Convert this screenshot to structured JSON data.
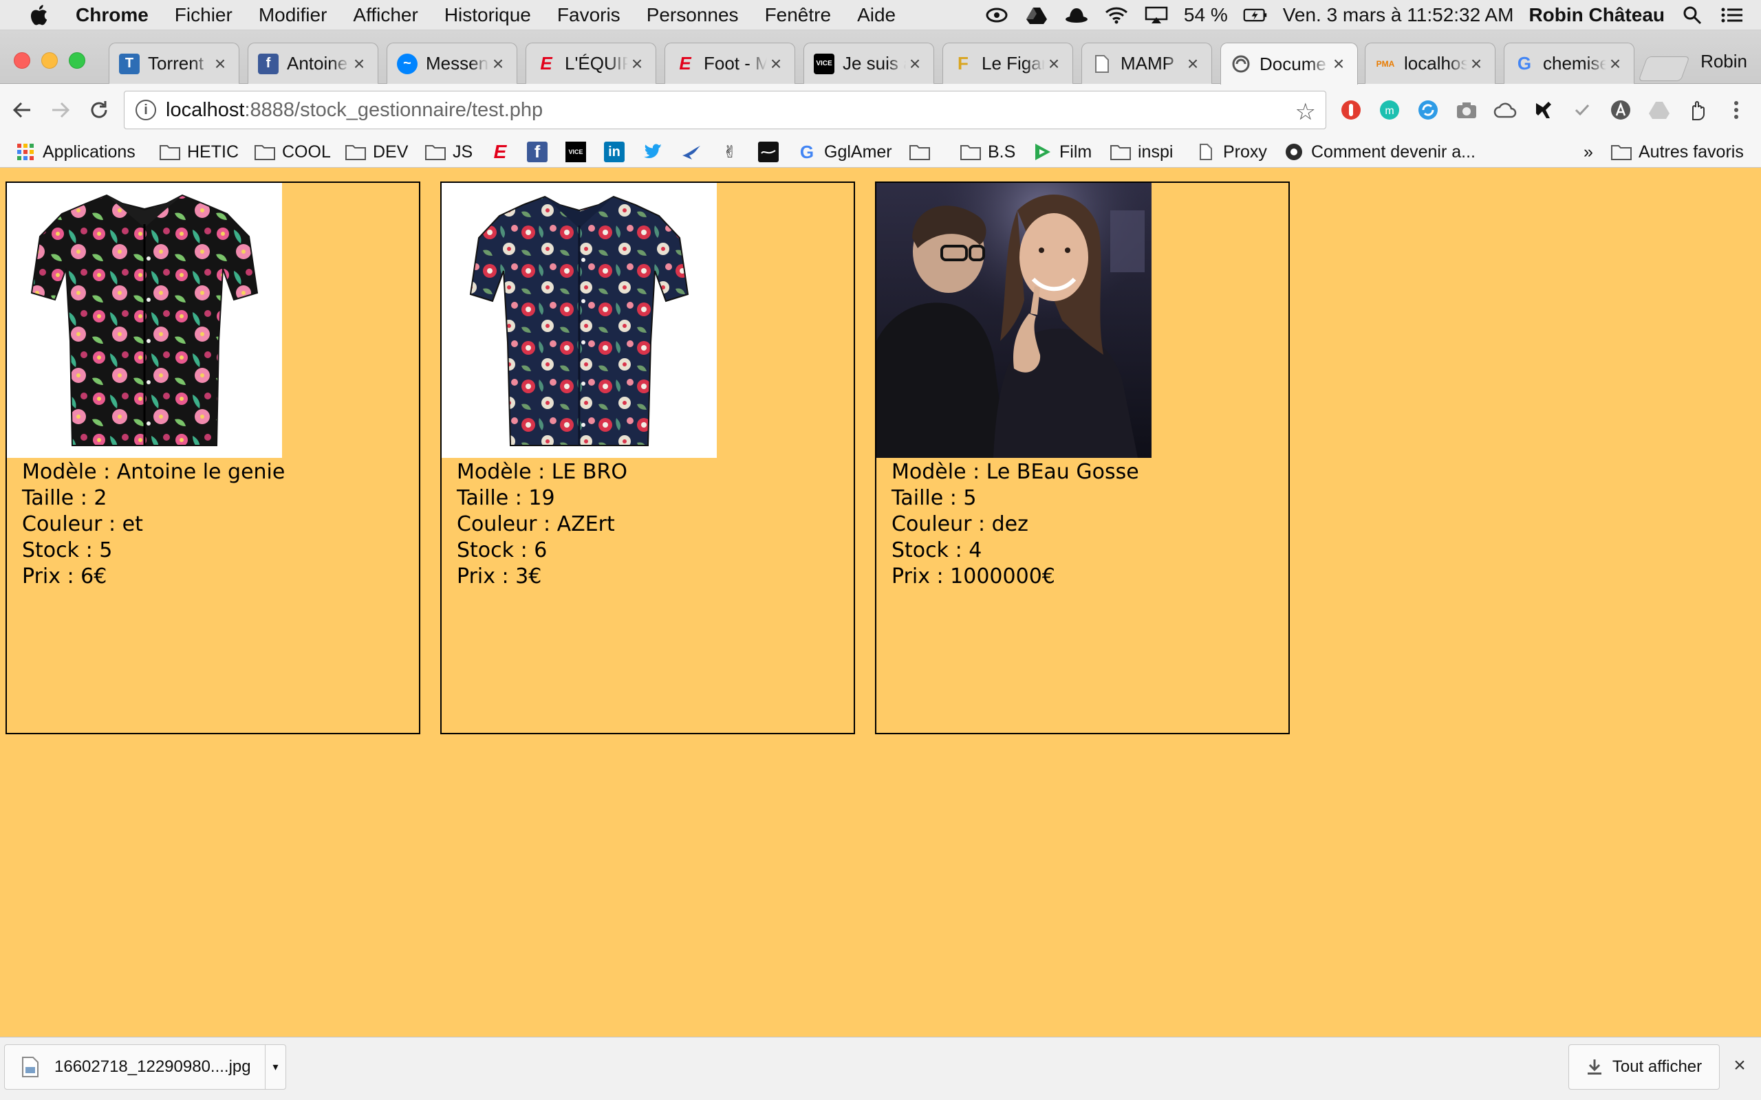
{
  "menubar": {
    "app_name": "Chrome",
    "items": [
      "Fichier",
      "Modifier",
      "Afficher",
      "Historique",
      "Favoris",
      "Personnes",
      "Fenêtre",
      "Aide"
    ],
    "battery": "54 %",
    "datetime": "Ven. 3 mars à  11:52:32 AM",
    "user": "Robin Château"
  },
  "tabs": [
    {
      "title": "Torrent",
      "favicon": "t9-icon",
      "color": "#2d6db5"
    },
    {
      "title": "Antoine",
      "favicon": "facebook-icon",
      "color": "#3b5998"
    },
    {
      "title": "Messenger",
      "favicon": "messenger-icon",
      "color": "#0084ff"
    },
    {
      "title": "L'ÉQUIPE",
      "favicon": "lequipe-icon",
      "color": "#e2001a"
    },
    {
      "title": "Foot - M",
      "favicon": "lequipe-icon",
      "color": "#e2001a"
    },
    {
      "title": "Je suis a",
      "favicon": "vice-icon",
      "color": "#000000"
    },
    {
      "title": "Le Figaro",
      "favicon": "figaro-icon",
      "color": "#d9a520"
    },
    {
      "title": "MAMP",
      "favicon": "page-icon",
      "color": "#777777"
    },
    {
      "title": "Docume",
      "favicon": "globe-icon",
      "color": "#555555",
      "active": true
    },
    {
      "title": "localhos",
      "favicon": "pma-icon",
      "color": "#e87b00"
    },
    {
      "title": "chemise",
      "favicon": "google-icon",
      "color": "#4285f4"
    }
  ],
  "profile_name": "Robin",
  "omnibox": {
    "host": "localhost",
    "path": ":8888/stock_gestionnaire/test.php"
  },
  "bookmarks": [
    {
      "label": "Applications",
      "icon": "apps-grid-icon"
    },
    {
      "label": "HETIC",
      "icon": "folder-icon"
    },
    {
      "label": "COOL",
      "icon": "folder-icon"
    },
    {
      "label": "DEV",
      "icon": "folder-icon"
    },
    {
      "label": "JS",
      "icon": "folder-icon"
    },
    {
      "label": "",
      "icon": "lequipe-icon"
    },
    {
      "label": "",
      "icon": "facebook-icon"
    },
    {
      "label": "",
      "icon": "vice-icon"
    },
    {
      "label": "",
      "icon": "linkedin-icon"
    },
    {
      "label": "",
      "icon": "twitter-icon"
    },
    {
      "label": "",
      "icon": "bird-icon"
    },
    {
      "label": "",
      "icon": "peace-hand-icon"
    },
    {
      "label": "",
      "icon": "dark-square-icon"
    },
    {
      "label": "GglAmer",
      "icon": "google-icon"
    },
    {
      "label": "",
      "icon": "folder-icon"
    },
    {
      "label": "B.S",
      "icon": "folder-icon"
    },
    {
      "label": "Film",
      "icon": "play-icon"
    },
    {
      "label": "inspi",
      "icon": "folder-icon"
    },
    {
      "label": "Proxy",
      "icon": "page-icon"
    },
    {
      "label": "Comment devenir a...",
      "icon": "badge-icon"
    }
  ],
  "bookmarks_overflow": "»",
  "other_bookmarks": "Autres favoris",
  "products": [
    {
      "modele_label": "Modèle : Antoine le genie",
      "taille_label": "Taille : 2",
      "couleur_label": "Couleur : et",
      "stock_label": "Stock : 5",
      "prix_label": "Prix : 6€",
      "image": "black-floral-shirt"
    },
    {
      "modele_label": "Modèle : LE BRO",
      "taille_label": "Taille : 19",
      "couleur_label": "Couleur : AZErt",
      "stock_label": "Stock : 6",
      "prix_label": "Prix : 3€",
      "image": "navy-floral-shirt"
    },
    {
      "modele_label": "Modèle : Le BEau Gosse",
      "taille_label": "Taille : 5",
      "couleur_label": "Couleur : dez",
      "stock_label": "Stock : 4",
      "prix_label": "Prix : 1000000€",
      "image": "couple-photo"
    }
  ],
  "download": {
    "filename": "16602718_12290980....jpg",
    "show_all": "Tout afficher"
  },
  "colors": {
    "page_background": "#ffcb66"
  }
}
